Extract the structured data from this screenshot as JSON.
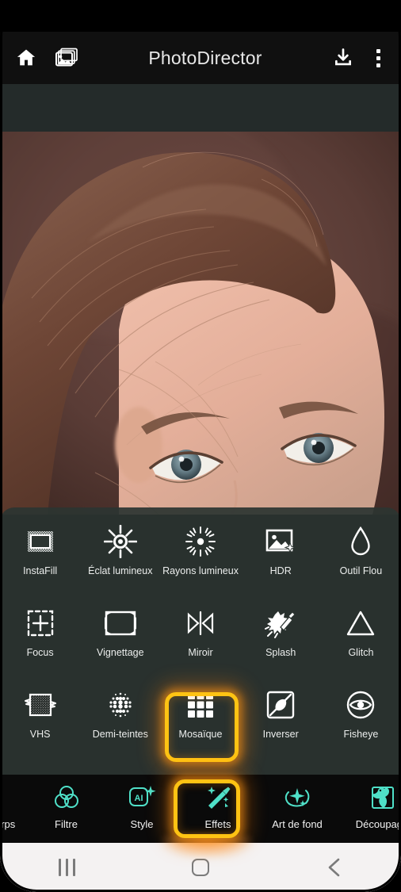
{
  "header": {
    "title": "PhotoDirector",
    "home_icon": "home-icon",
    "gallery_icon": "gallery-icon",
    "download_icon": "download-icon",
    "menu_icon": "overflow-menu-icon"
  },
  "effects_panel": {
    "rows": [
      [
        {
          "label": "InstaFill",
          "icon": "instafill-icon",
          "selected": false
        },
        {
          "label": "Éclat lumineux",
          "icon": "starburst-icon",
          "selected": false
        },
        {
          "label": "Rayons lumineux",
          "icon": "light-rays-icon",
          "selected": false
        },
        {
          "label": "HDR",
          "icon": "hdr-photo-icon",
          "selected": false
        },
        {
          "label": "Outil Flou",
          "icon": "blur-droplet-icon",
          "selected": false
        }
      ],
      [
        {
          "label": "Focus",
          "icon": "focus-crosshair-icon",
          "selected": false
        },
        {
          "label": "Vignettage",
          "icon": "vignette-icon",
          "selected": false
        },
        {
          "label": "Miroir",
          "icon": "mirror-icon",
          "selected": false
        },
        {
          "label": "Splash",
          "icon": "splash-brush-icon",
          "selected": false
        },
        {
          "label": "Glitch",
          "icon": "glitch-triangle-icon",
          "selected": false
        }
      ],
      [
        {
          "label": "VHS",
          "icon": "vhs-icon",
          "selected": false
        },
        {
          "label": "Demi-teintes",
          "icon": "halftone-icon",
          "selected": false
        },
        {
          "label": "Mosaïque",
          "icon": "mosaic-grid-icon",
          "selected": true
        },
        {
          "label": "Inverser",
          "icon": "invert-icon",
          "selected": false
        },
        {
          "label": "Fisheye",
          "icon": "fisheye-eye-icon",
          "selected": false
        }
      ]
    ]
  },
  "bottom_toolbar": {
    "partial_label": "orps",
    "items": [
      {
        "label": "Filtre",
        "icon": "filter-circles-icon",
        "selected": false
      },
      {
        "label": "Style",
        "icon": "ai-style-icon",
        "selected": false
      },
      {
        "label": "Effets",
        "icon": "magic-wand-icon",
        "selected": true
      },
      {
        "label": "Art de fond",
        "icon": "background-art-icon",
        "selected": false
      },
      {
        "label": "Découpage",
        "icon": "cutout-icon",
        "selected": false
      }
    ]
  },
  "android_nav": {
    "recents": "recents-icon",
    "home": "home-square-icon",
    "back": "back-chevron-icon"
  },
  "colors": {
    "highlight": "#FFC313",
    "accent_teal": "#4FE0C8",
    "panel_bg": "#2C3532",
    "toolbar_bg": "#0A0A0A",
    "header_bg": "#101010"
  }
}
